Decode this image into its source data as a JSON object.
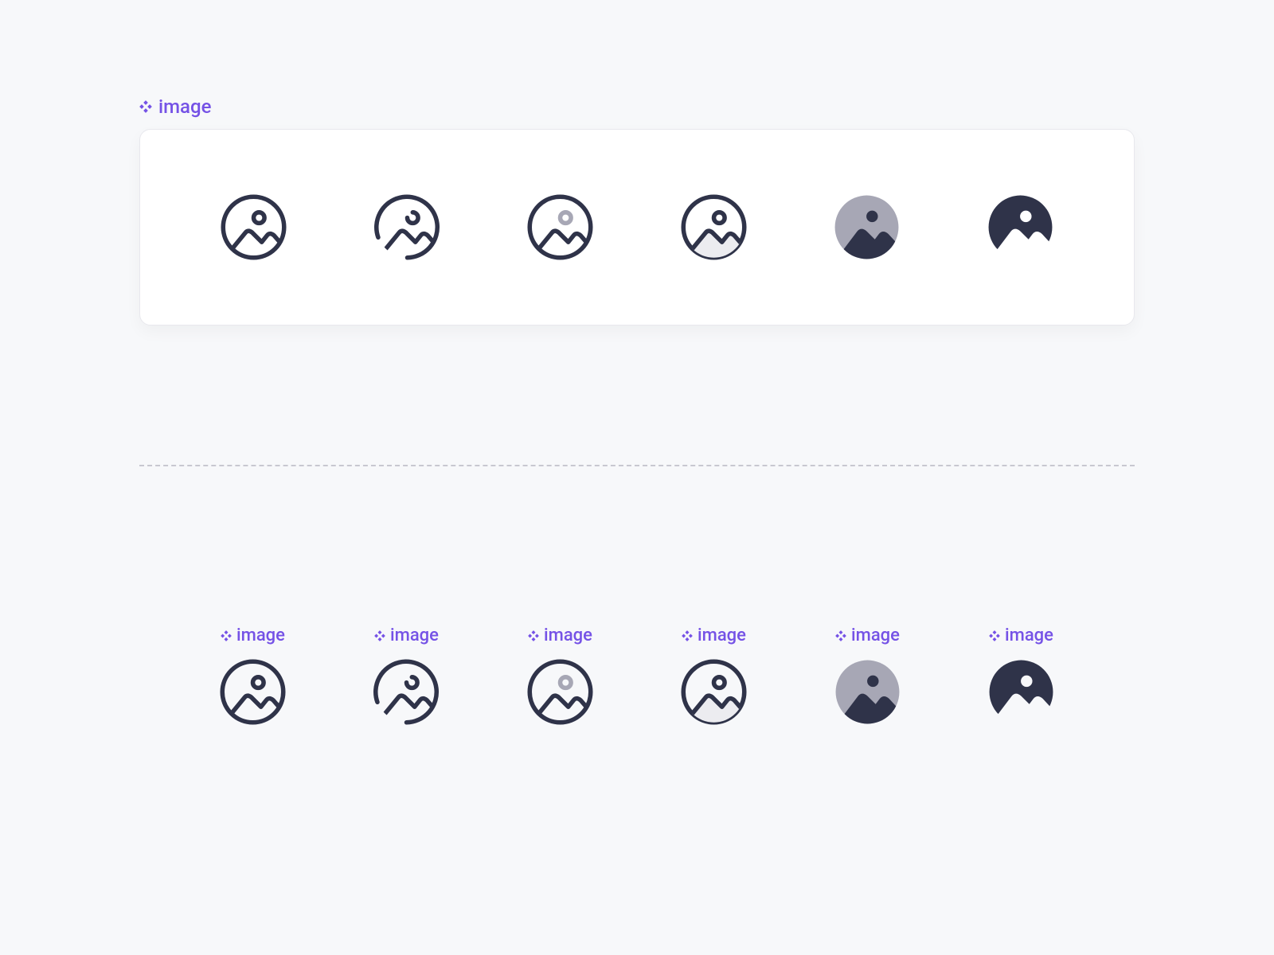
{
  "colors": {
    "accent": "#7552e6",
    "dark": "#2f3349",
    "grey": "#a7a7b5",
    "lightGrey": "#e5e5ea",
    "background": "#f7f8fa"
  },
  "section_top": {
    "label": "image",
    "icons": [
      {
        "variant": "outline"
      },
      {
        "variant": "broken"
      },
      {
        "variant": "twotone"
      },
      {
        "variant": "bulk-light"
      },
      {
        "variant": "bulk-grey"
      },
      {
        "variant": "bold"
      }
    ]
  },
  "section_bottom": {
    "items": [
      {
        "label": "image",
        "variant": "outline"
      },
      {
        "label": "image",
        "variant": "broken"
      },
      {
        "label": "image",
        "variant": "twotone"
      },
      {
        "label": "image",
        "variant": "bulk-light"
      },
      {
        "label": "image",
        "variant": "bulk-grey"
      },
      {
        "label": "image",
        "variant": "bold"
      }
    ]
  }
}
